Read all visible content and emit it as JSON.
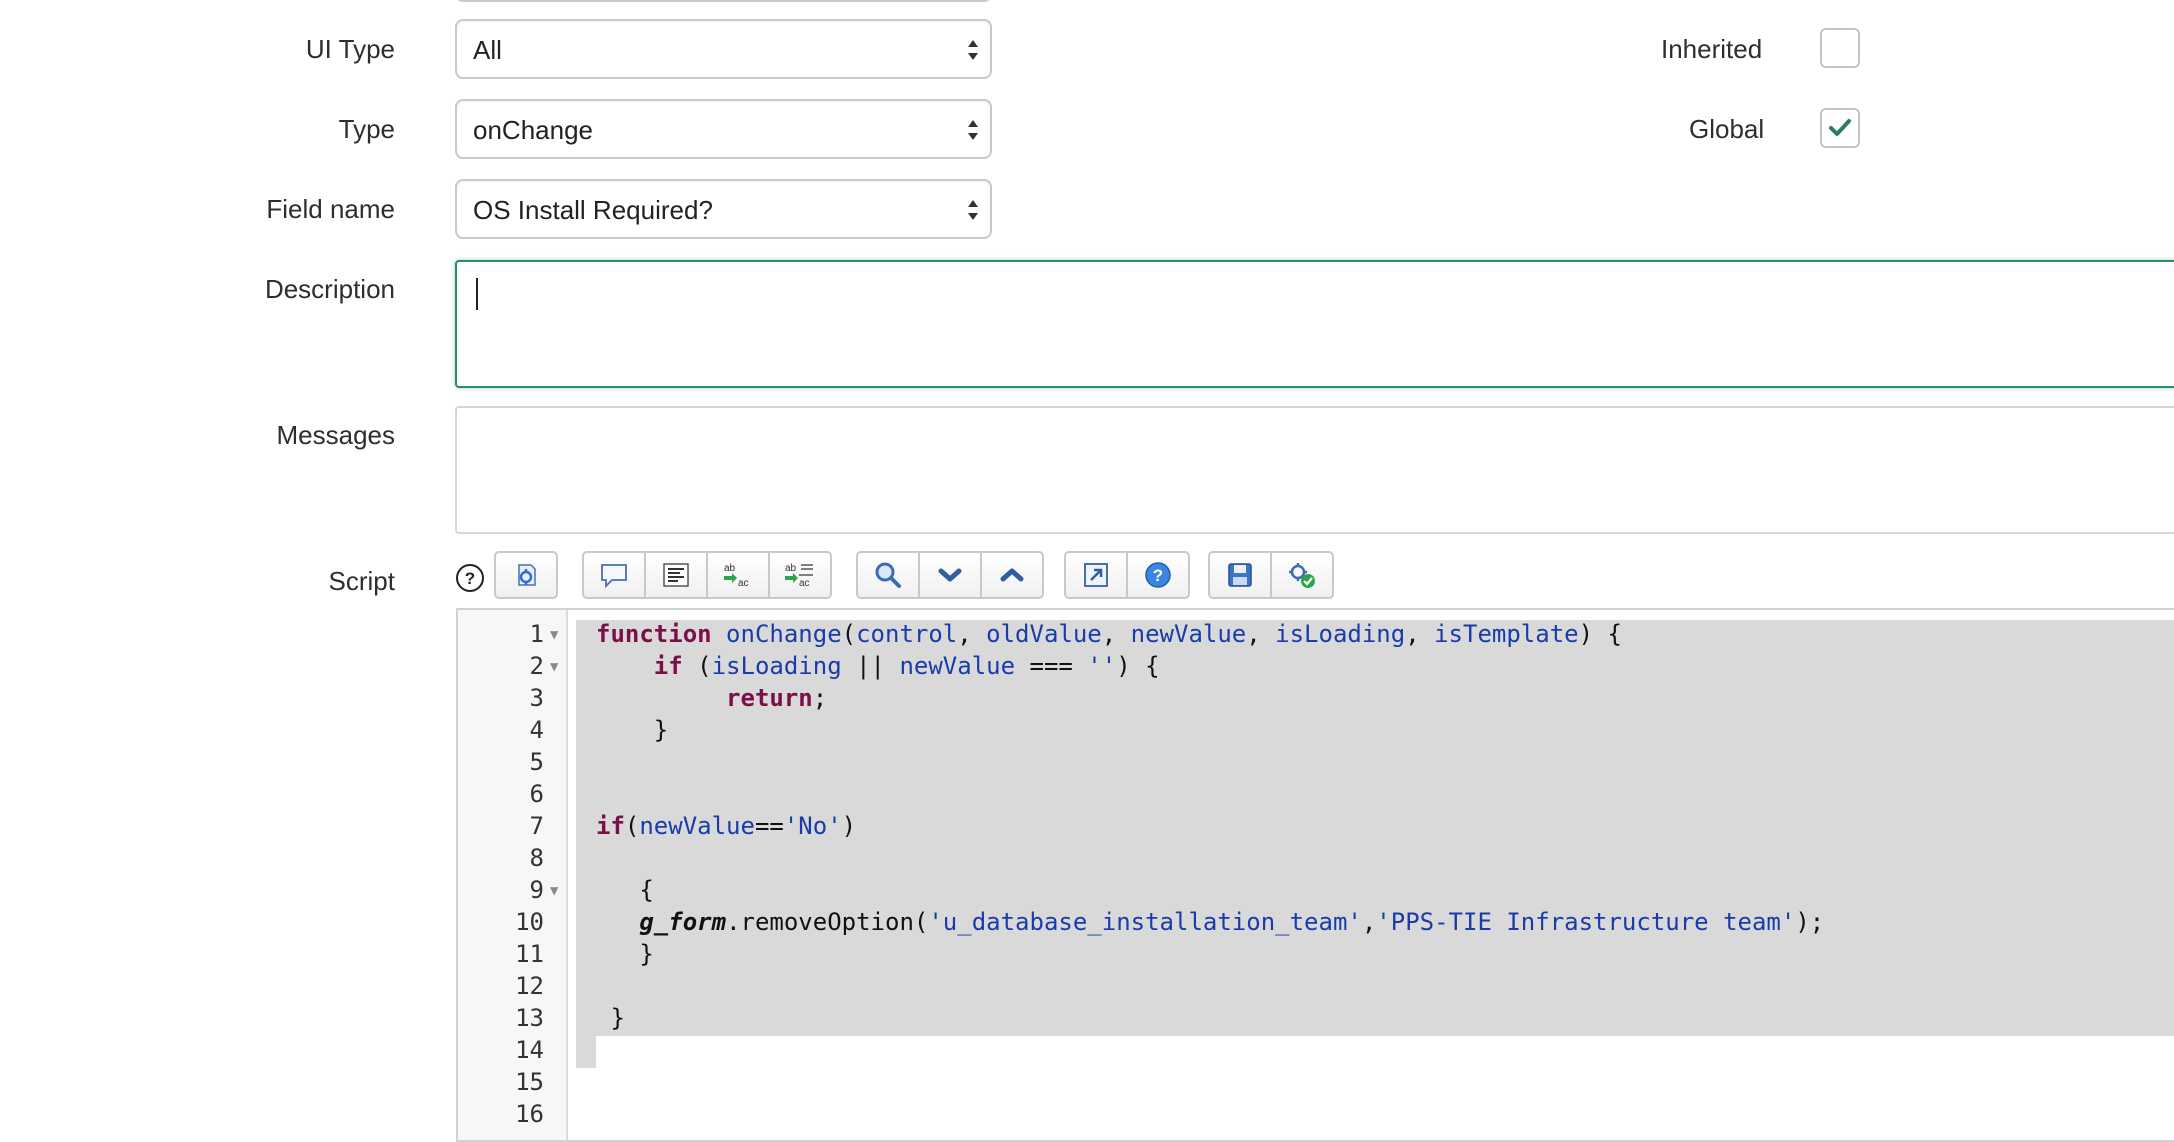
{
  "form": {
    "ui_type": {
      "label": "UI Type",
      "value": "All"
    },
    "type": {
      "label": "Type",
      "value": "onChange"
    },
    "field_name": {
      "label": "Field name",
      "value": "OS Install Required?"
    },
    "description": {
      "label": "Description",
      "value": ""
    },
    "messages": {
      "label": "Messages",
      "value": ""
    },
    "script": {
      "label": "Script"
    },
    "inherited": {
      "label": "Inherited",
      "checked": false
    },
    "global": {
      "label": "Global",
      "checked": true
    }
  },
  "toolbar": {
    "icons": [
      "help-icon",
      "script-include-icon",
      "comment-icon",
      "format-code-icon",
      "replace-icon",
      "replace-all-icon",
      "search-icon",
      "next-icon",
      "previous-icon",
      "fullscreen-icon",
      "help-circle-icon",
      "save-icon",
      "syntax-check-icon"
    ]
  },
  "editor": {
    "line_numbers": [
      "1",
      "2",
      "3",
      "4",
      "5",
      "6",
      "7",
      "8",
      "9",
      "10",
      "11",
      "12",
      "13",
      "14",
      "15",
      "16"
    ],
    "fold_lines": [
      "1",
      "2",
      "9"
    ],
    "tokens": {
      "l1": [
        "function",
        "onChange",
        "(",
        "control",
        ", ",
        "oldValue",
        ", ",
        "newValue",
        ", ",
        "isLoading",
        ", ",
        "isTemplate",
        ") {"
      ],
      "l2": [
        "    ",
        "if",
        " (",
        "isLoading",
        " || ",
        "newValue",
        " === ",
        "''",
        ") {"
      ],
      "l3": [
        "         ",
        "return",
        ";"
      ],
      "l4": "    }",
      "l7": [
        "if",
        "(",
        "newValue",
        "==",
        "'No'",
        ")"
      ],
      "l9": "   {",
      "l10": [
        "   ",
        "g_form",
        ".removeOption(",
        "'u_database_installation_team'",
        ",",
        "'PPS-TIE Infrastructure team'",
        ");"
      ],
      "l11": "   }",
      "l13": " }"
    }
  }
}
